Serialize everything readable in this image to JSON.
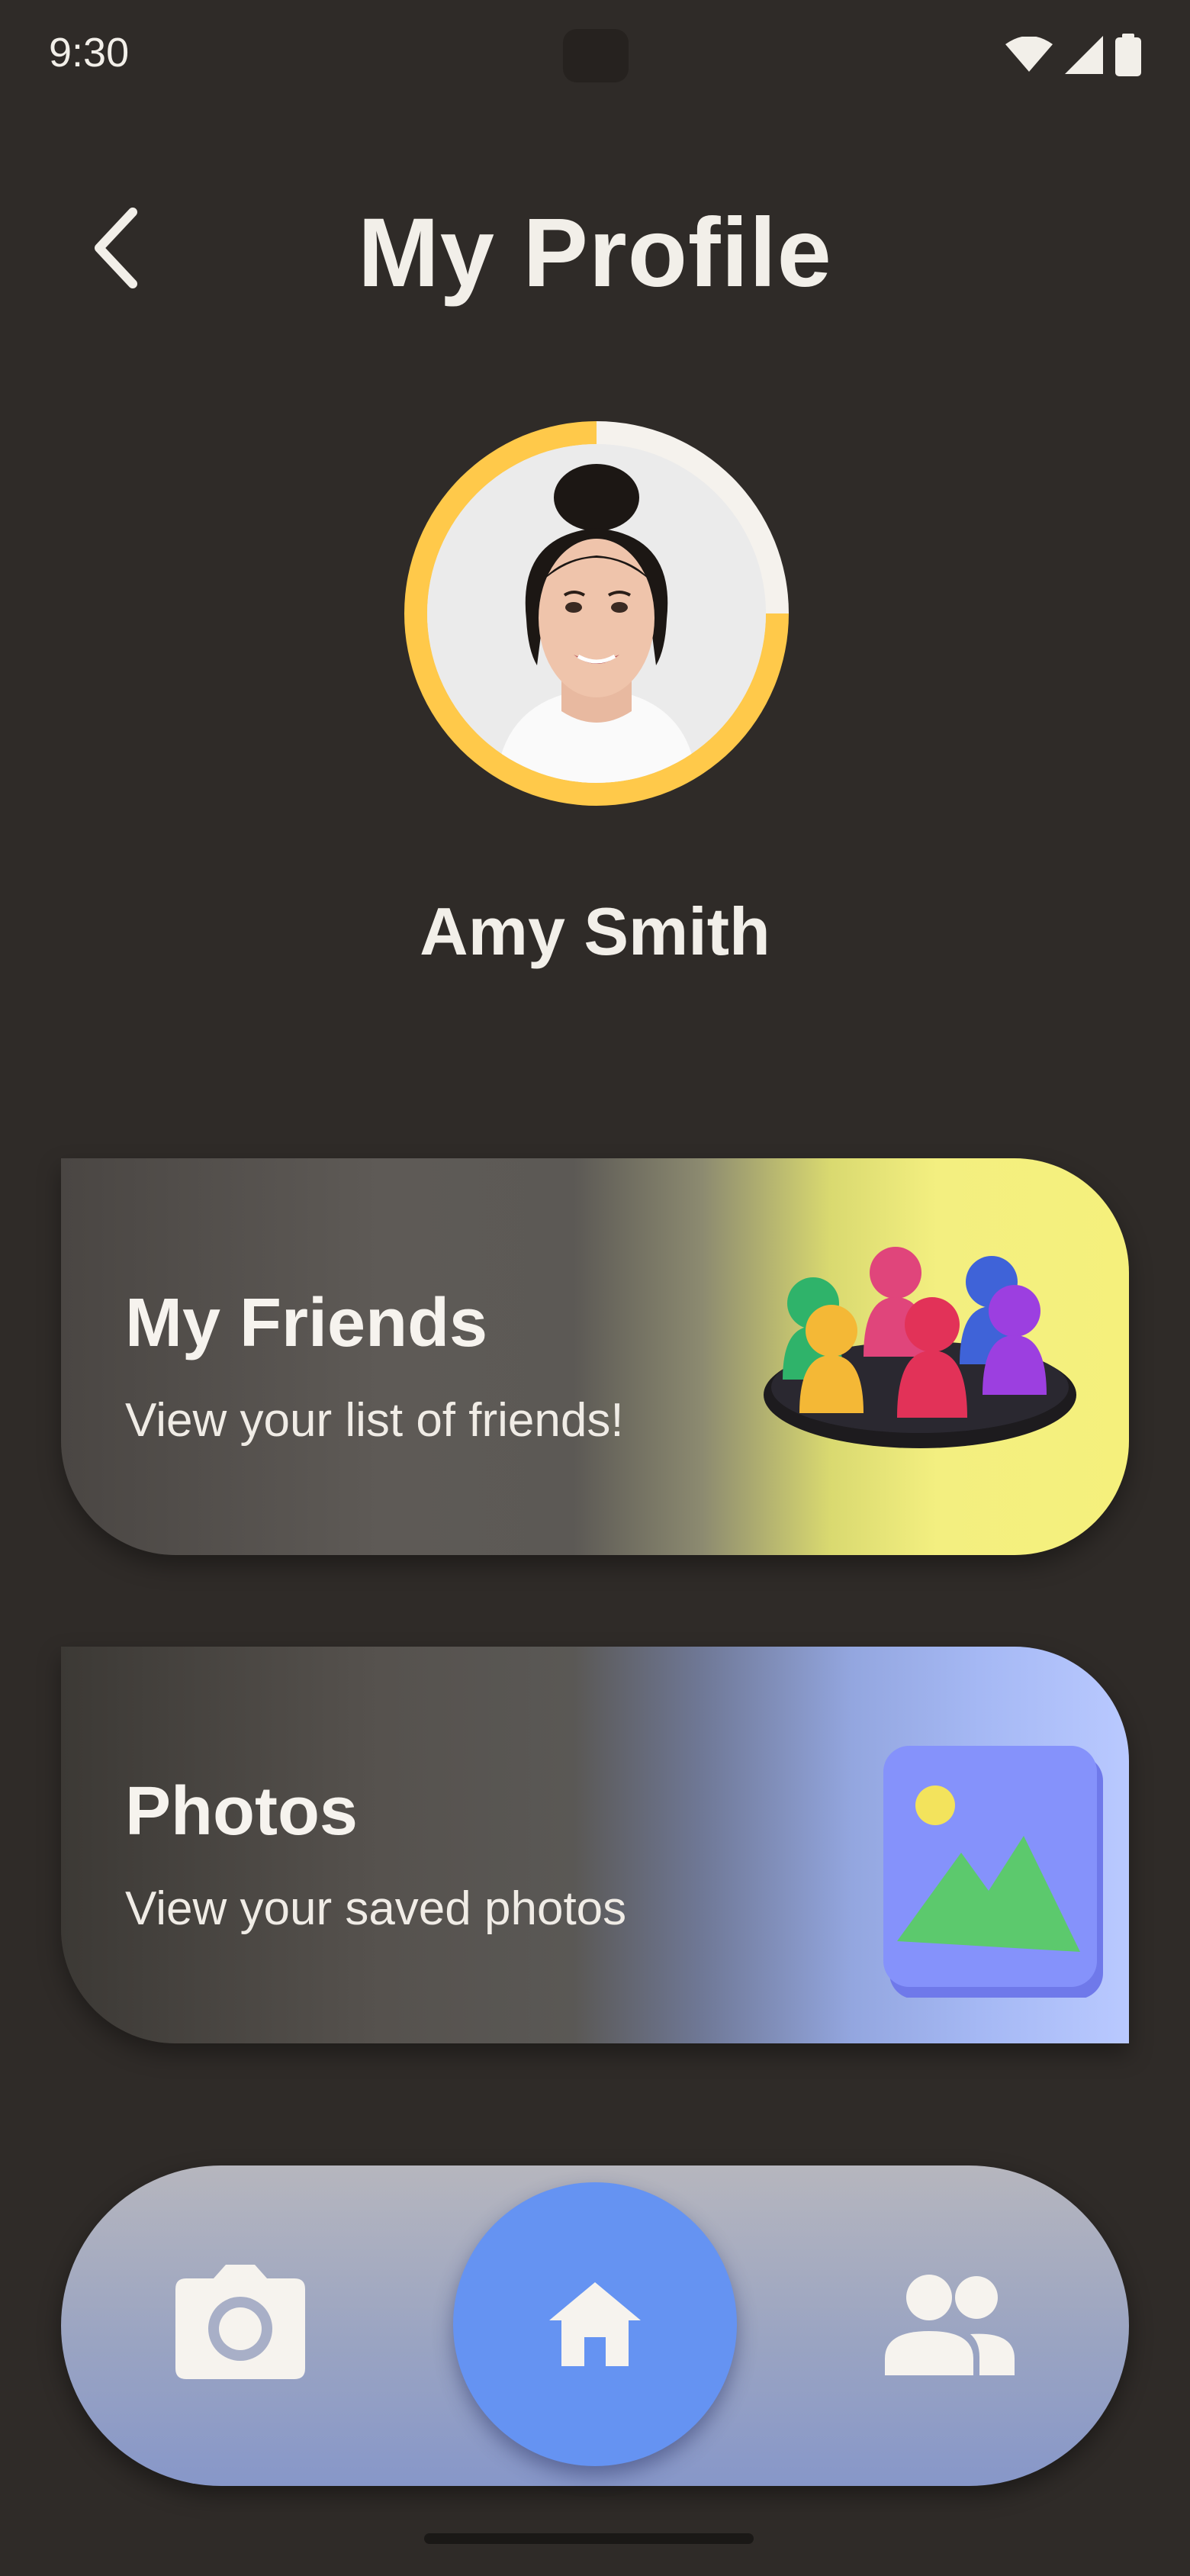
{
  "status_bar": {
    "time": "9:30"
  },
  "header": {
    "title": "My Profile"
  },
  "profile": {
    "name": "Amy Smith",
    "ring_colors": {
      "active": "#ffc94a",
      "inactive": "#f5f2ed"
    }
  },
  "cards": [
    {
      "title": "My Friends",
      "subtitle": "View your list of friends!",
      "accent": "#f5f07c"
    },
    {
      "title": "Photos",
      "subtitle": "View your saved photos",
      "accent": "#b9c9ff"
    }
  ],
  "bottom_nav": {
    "items": [
      {
        "icon": "camera-icon"
      },
      {
        "icon": "home-icon",
        "active": true
      },
      {
        "icon": "people-icon"
      }
    ],
    "active_color": "#6593f2"
  }
}
